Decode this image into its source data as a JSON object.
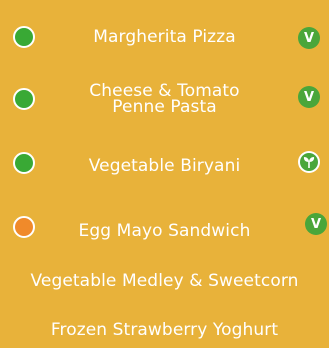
{
  "colors": {
    "background": "#e8b23a",
    "dot_green": "#39a935",
    "dot_orange": "#f08a2a",
    "badge_green": "#4aa63a"
  },
  "menu": {
    "items": [
      {
        "name": "Margherita Pizza",
        "dot": "green",
        "badge": "vegetarian-v-icon",
        "badge_text": "V"
      },
      {
        "name_line1": "Cheese & Tomato",
        "name_line2": "Penne Pasta",
        "dot": "green",
        "badge": "vegetarian-v-icon",
        "badge_text": "V"
      },
      {
        "name": "Vegetable Biryani",
        "dot": "green",
        "badge": "vegan-leaf-icon"
      },
      {
        "name": "Egg Mayo Sandwich",
        "dot": "orange",
        "badge": "vegetarian-v-icon",
        "badge_text": "V"
      },
      {
        "name": "Vegetable Medley & Sweetcorn"
      },
      {
        "name": "Frozen Strawberry Yoghurt"
      }
    ]
  }
}
